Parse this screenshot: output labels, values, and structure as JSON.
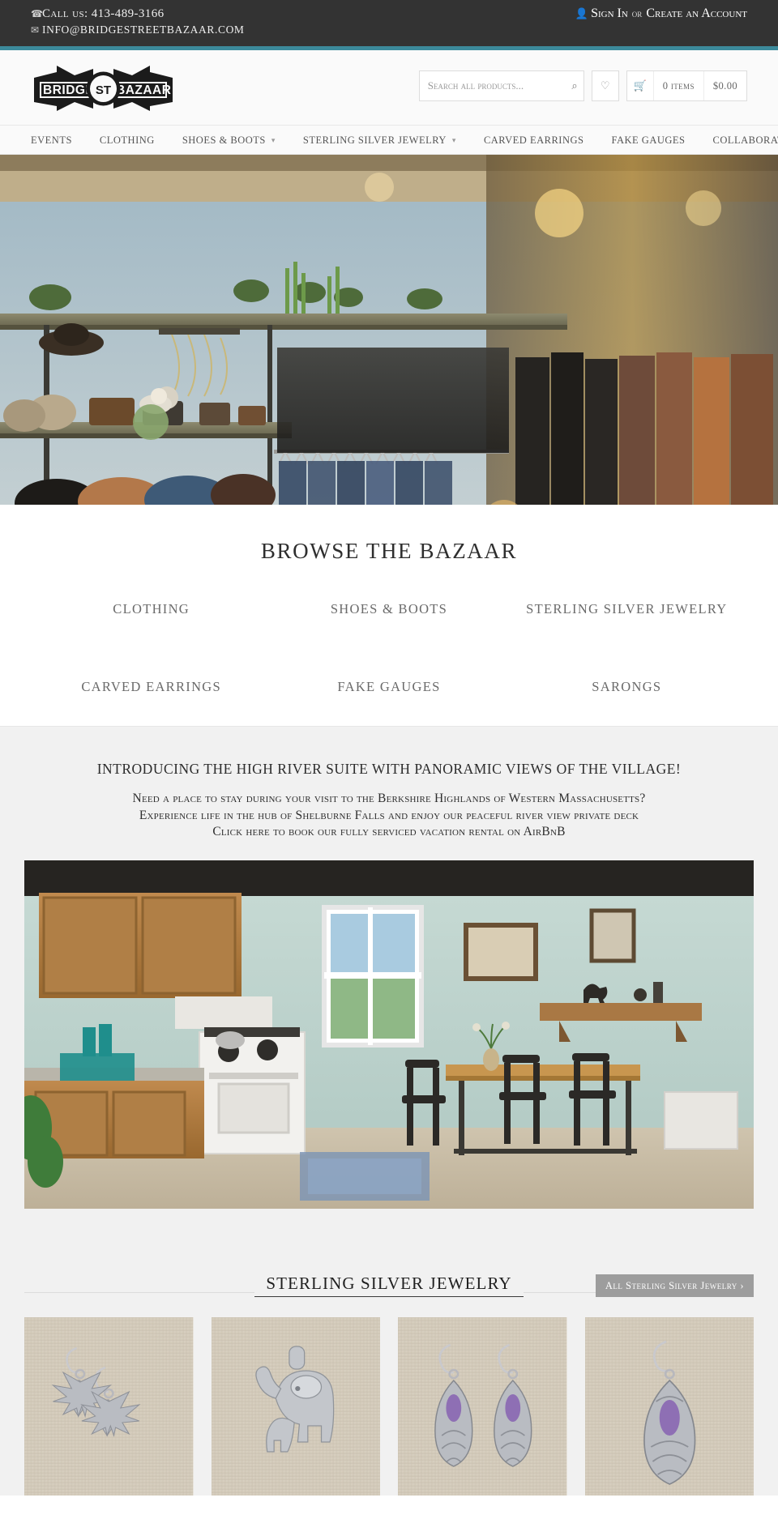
{
  "topbar": {
    "phone_icon": "phone-icon",
    "phone_label": "Call us: 413-489-3166",
    "email_icon": "envelope-icon",
    "email_label": "INFO@BRIDGESTREETBAZAAR.COM",
    "user_icon": "user-icon",
    "sign_in": "Sign In",
    "or": "or",
    "create_account": "Create an Account",
    "accent_color": "#3c8a9b",
    "bg_color": "#333333"
  },
  "header": {
    "logo_text_left": "BRIDGE",
    "logo_text_mid": "ST",
    "logo_text_right": "BAZAAR",
    "logo_alt": "Bridge St Bazaar",
    "search": {
      "placeholder": "Search all products...",
      "value": "",
      "button_icon": "search-icon",
      "button_glyph": "⌕"
    },
    "wishlist_icon": "heart-icon",
    "cart": {
      "icon": "cart-icon",
      "items_label": "0 items",
      "total_label": "$0.00"
    }
  },
  "nav": {
    "items": [
      {
        "label": "Events",
        "has_dropdown": false
      },
      {
        "label": "Clothing",
        "has_dropdown": false
      },
      {
        "label": "Shoes & Boots",
        "has_dropdown": true
      },
      {
        "label": "Sterling Silver Jewelry",
        "has_dropdown": true
      },
      {
        "label": "Carved Earrings",
        "has_dropdown": false
      },
      {
        "label": "Fake Gauges",
        "has_dropdown": false
      },
      {
        "label": "Collaborate With Us",
        "has_dropdown": false
      }
    ],
    "caret_glyph": "▾"
  },
  "hero": {
    "alt": "Interior of Bridge St Bazaar shop with hats, jewelry, bags and racks of clothing"
  },
  "browse": {
    "title": "BROWSE THE BAZAAR",
    "categories": [
      "CLOTHING",
      "SHOES & BOOTS",
      "STERLING SILVER JEWELRY",
      "CARVED EARRINGS",
      "FAKE GAUGES",
      "SARONGS"
    ]
  },
  "promo": {
    "heading": "INTRODUCING THE HIGH RIVER SUITE WITH PANORAMIC VIEWS OF THE VILLAGE!",
    "line1": "Need a place to stay during your visit to the Berkshire Highlands of Western Massachusetts?",
    "line2": "Experience life in the hub of Shelburne Falls and enjoy our peaceful river view private deck",
    "line3": "Click here to book our fully serviced vacation rental on AirBnB",
    "image_alt": "High River Suite kitchen and dining area with wooden cabinets, table and chairs"
  },
  "products": {
    "section_title": "STERLING SILVER JEWELRY",
    "all_button": "All Sterling Silver Jewelry ›",
    "items": [
      {
        "alt": "Sterling silver cannabis leaf dangle earrings on linen"
      },
      {
        "alt": "Sterling silver elephant mother and calf pendant on linen"
      },
      {
        "alt": "Sterling silver filigree teardrop earrings with amethyst on linen"
      },
      {
        "alt": "Sterling silver ornate marquise earrings with amethyst on linen"
      }
    ]
  }
}
